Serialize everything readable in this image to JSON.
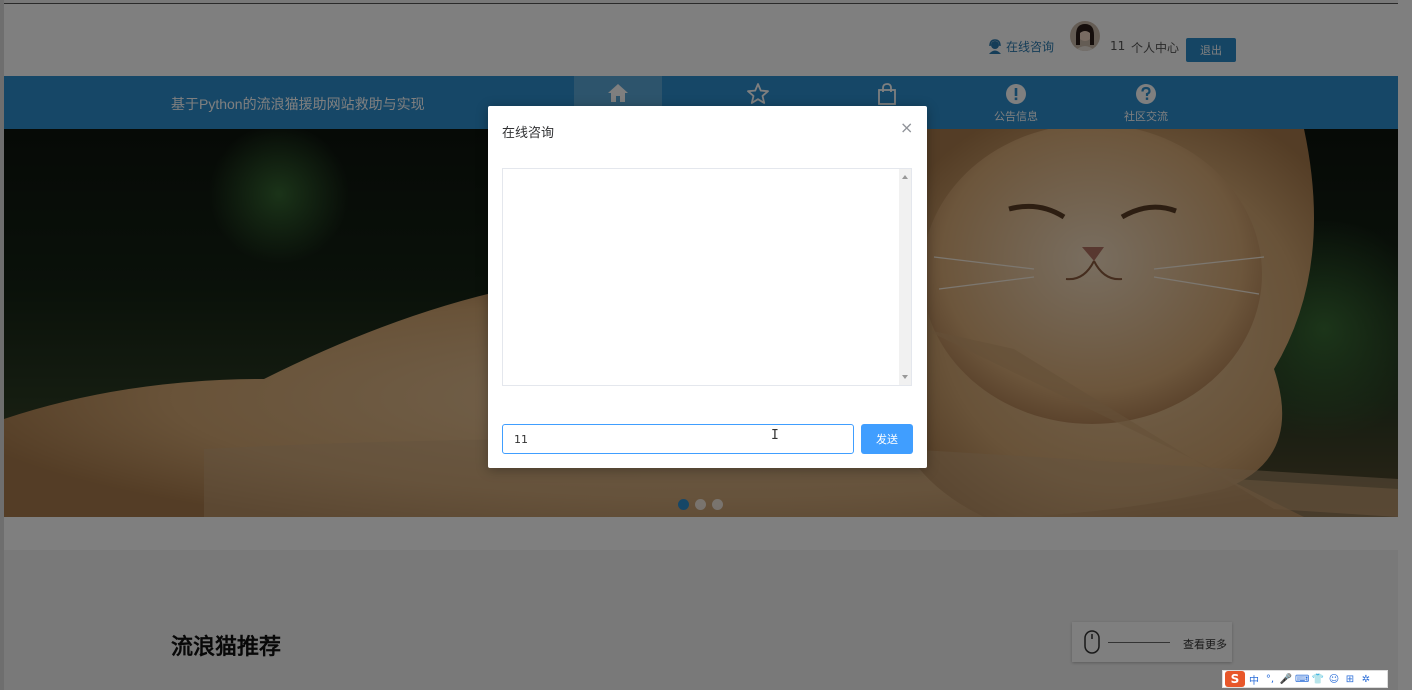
{
  "topbar": {
    "consult_label": "在线咨询",
    "username": "11",
    "personal_center": "个人中心",
    "logout": "退出"
  },
  "navbar": {
    "site_title": "基于Python的流浪猫援助网站救助与实现",
    "items": [
      {
        "label": "",
        "icon": "home-icon",
        "active": true
      },
      {
        "label": "",
        "icon": "star-icon"
      },
      {
        "label": "",
        "icon": "shopping-bag-icon"
      },
      {
        "label": "公告信息",
        "icon": "exclamation-circle-icon"
      },
      {
        "label": "社区交流",
        "icon": "question-circle-icon"
      }
    ]
  },
  "carousel": {
    "dots": 3,
    "active_index": 0
  },
  "section": {
    "title": "流浪猫推荐",
    "more_label": "查看更多"
  },
  "modal": {
    "title": "在线咨询",
    "input_value": "11",
    "send_label": "发送"
  },
  "ime": {
    "logo": "S",
    "items": [
      "中",
      "°,",
      "🎤",
      "⌨",
      "👕",
      "☺",
      "⊞",
      "✲"
    ]
  },
  "colors": {
    "nav_bg": "#2d8fcf",
    "primary": "#409eff"
  }
}
